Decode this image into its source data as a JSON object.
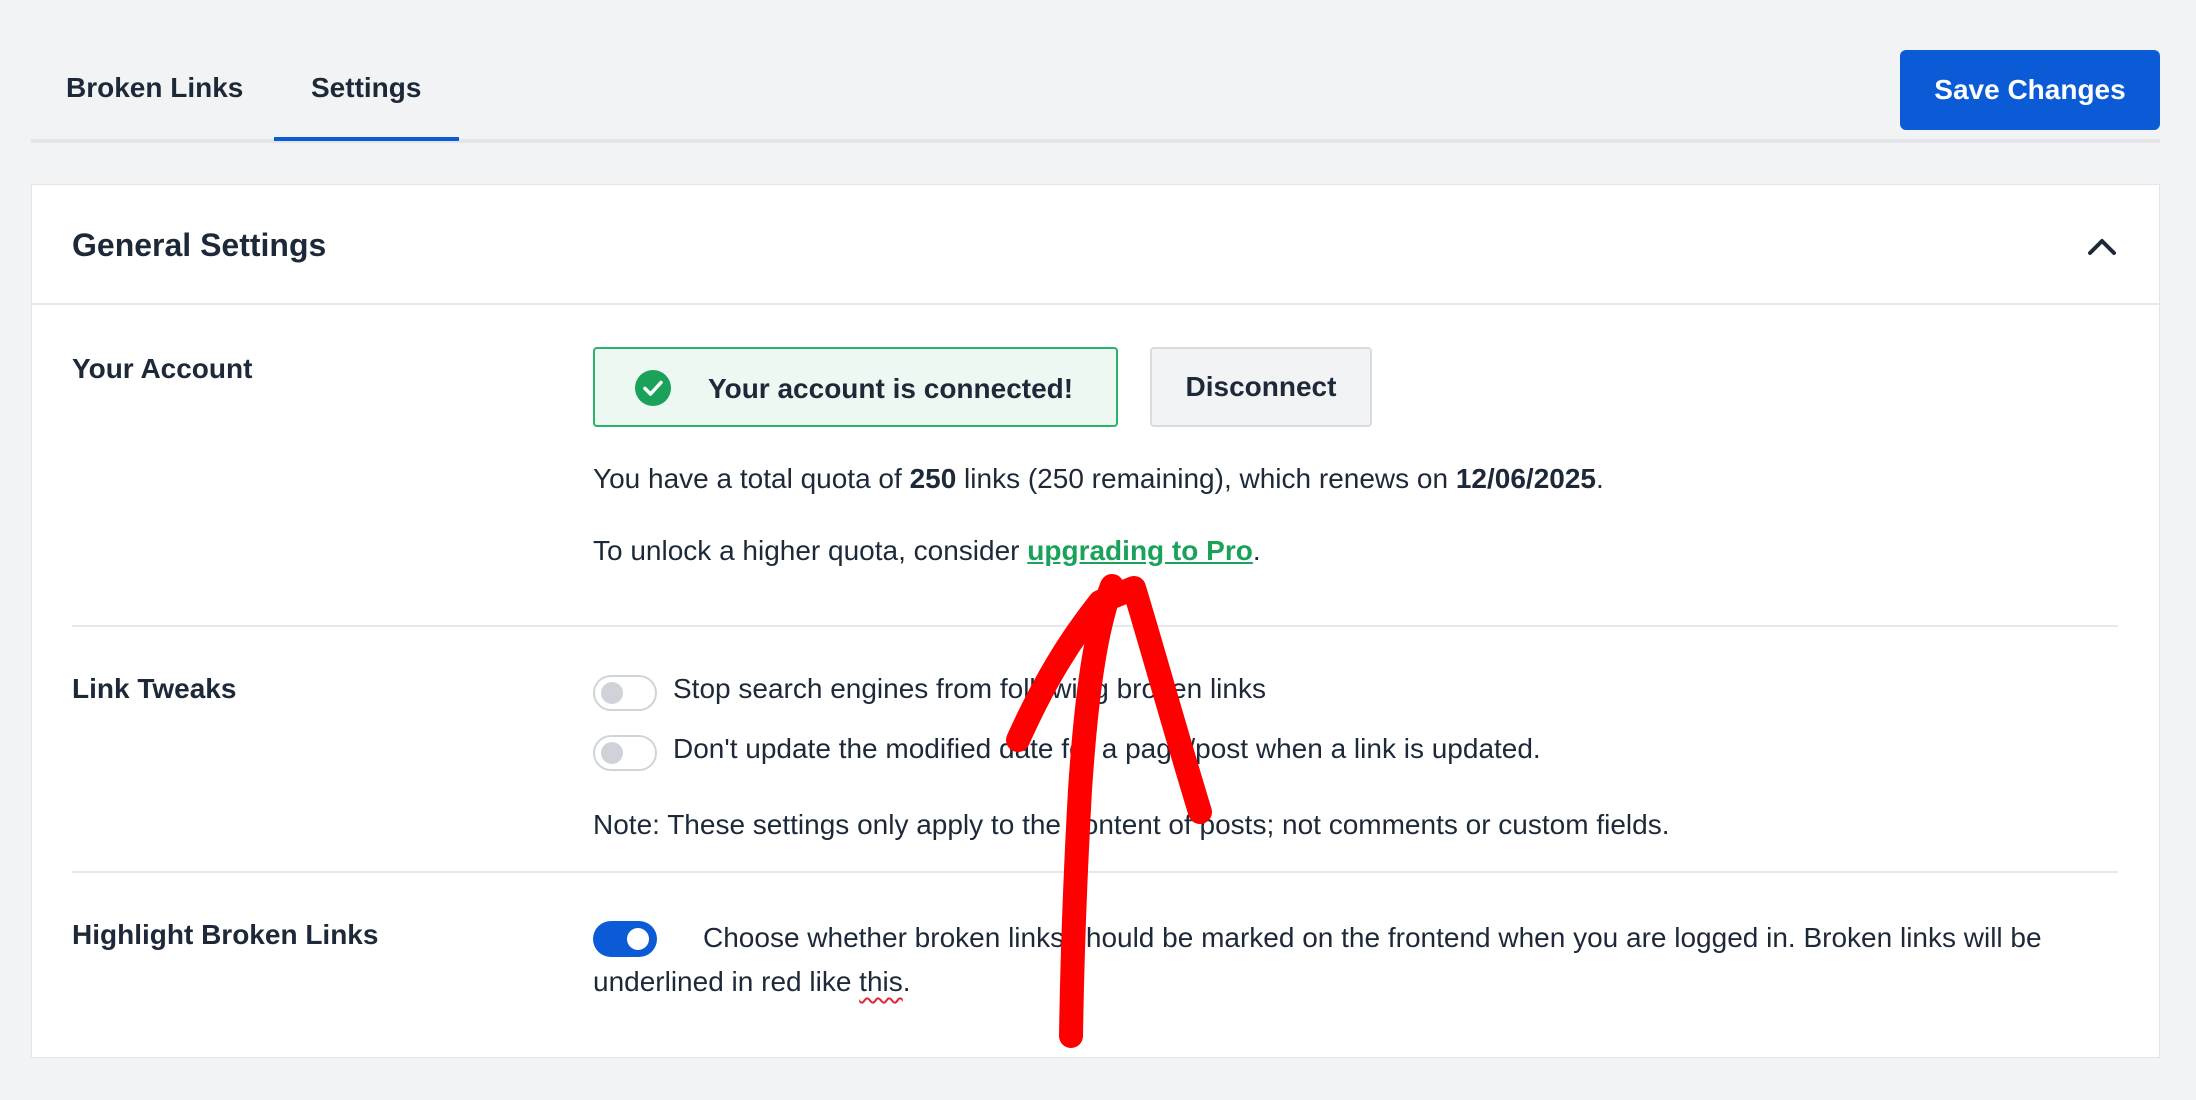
{
  "tabs": {
    "broken_links": "Broken Links",
    "settings": "Settings",
    "active": "Settings"
  },
  "toolbar": {
    "save_label": "Save Changes"
  },
  "general": {
    "title": "General Settings"
  },
  "account": {
    "label": "Your Account",
    "status": "Your account is connected!",
    "disconnect_label": "Disconnect",
    "quota_prefix": "You have a total quota of ",
    "quota_total": "250",
    "quota_middle": " links (250 remaining), which renews on ",
    "renew_date": "12/06/2025",
    "quota_suffix": ".",
    "unlock_prefix": "To unlock a higher quota, consider ",
    "upgrade_link": "upgrading to Pro",
    "unlock_suffix": "."
  },
  "link_tweaks": {
    "label": "Link Tweaks",
    "option1": "Stop search engines from following broken links",
    "option1_enabled": false,
    "option2": "Don't update the modified date for a page/post when a link is updated.",
    "option2_enabled": false,
    "note": "Note: These settings only apply to the content of posts; not comments or custom fields."
  },
  "highlight": {
    "label": "Highlight Broken Links",
    "enabled": true,
    "text_main": "Choose whether broken links should be marked on the frontend when you are logged in. Broken links will be underlined in red like ",
    "text_example": "this",
    "text_end": "."
  },
  "colors": {
    "accent": "#0b5bd7",
    "success": "#2bb36a",
    "link": "#1aa25a",
    "annotation": "#ff0000"
  },
  "icons": {
    "status": "check-circle-icon",
    "collapse": "chevron-up-icon"
  }
}
